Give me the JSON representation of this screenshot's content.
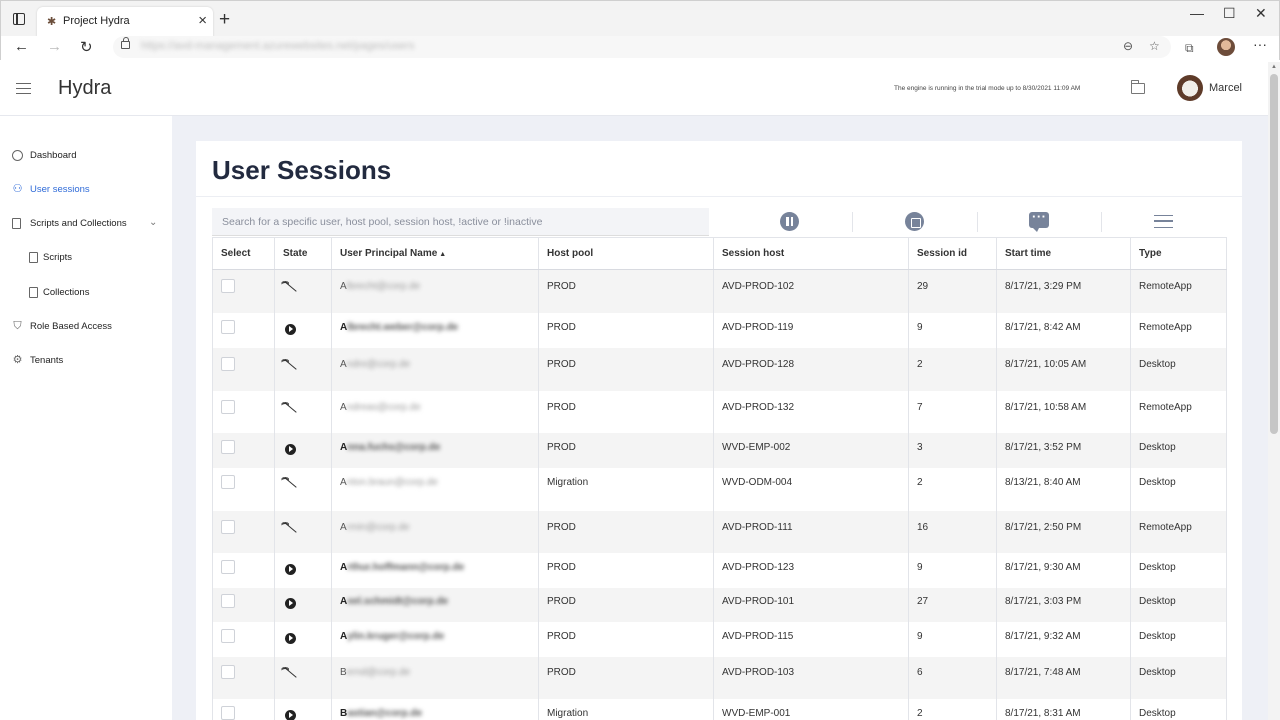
{
  "browser": {
    "tab_title": "Project Hydra",
    "url_blurred": "https://avd-management.azurewebsites.net/pages/users",
    "favicon": "hydra-favicon"
  },
  "header": {
    "app_title": "Hydra",
    "trial_note": "The engine is running in the trial mode up to 8/30/2021 11:09 AM",
    "user_name": "Marcel"
  },
  "sidebar": {
    "items": [
      {
        "label": "Dashboard",
        "icon": "dashboard-icon"
      },
      {
        "label": "User sessions",
        "icon": "users-icon",
        "active": true
      },
      {
        "label": "Scripts and Collections",
        "icon": "scripts-icon"
      },
      {
        "label": "Scripts",
        "icon": "page-icon"
      },
      {
        "label": "Collections",
        "icon": "page-icon"
      },
      {
        "label": "Role Based Access",
        "icon": "shield-icon"
      },
      {
        "label": "Tenants",
        "icon": "gear-icon"
      }
    ],
    "active_color": "#2f6bd8"
  },
  "main": {
    "title": "User Sessions",
    "search_placeholder": "Search for a specific user, host pool, session host, !active or !inactive",
    "actions": [
      "pause-icon",
      "stop-icon",
      "message-icon",
      "menu-icon"
    ]
  },
  "table": {
    "columns": [
      "Select",
      "State",
      "User Principal Name",
      "Host pool",
      "Session host",
      "Session id",
      "Start time",
      "Type"
    ],
    "sort_column": "User Principal Name",
    "rows": [
      {
        "state": "inactive",
        "upn_first": "A",
        "upn_blur": "lbrecht@corp.de",
        "host_pool": "PROD",
        "session_host": "AVD-PROD-102",
        "session_id": "29",
        "start_time": "8/17/21, 3:29 PM",
        "type": "RemoteApp"
      },
      {
        "state": "active",
        "upn_first": "A",
        "upn_blur": "lbrecht.weber@corp.de",
        "host_pool": "PROD",
        "session_host": "AVD-PROD-119",
        "session_id": "9",
        "start_time": "8/17/21, 8:42 AM",
        "type": "RemoteApp"
      },
      {
        "state": "inactive",
        "upn_first": "A",
        "upn_blur": "ndre@corp.de",
        "host_pool": "PROD",
        "session_host": "AVD-PROD-128",
        "session_id": "2",
        "start_time": "8/17/21, 10:05 AM",
        "type": "Desktop"
      },
      {
        "state": "inactive",
        "upn_first": "A",
        "upn_blur": "ndreas@corp.de",
        "host_pool": "PROD",
        "session_host": "AVD-PROD-132",
        "session_id": "7",
        "start_time": "8/17/21, 10:58 AM",
        "type": "RemoteApp"
      },
      {
        "state": "active",
        "upn_first": "A",
        "upn_blur": "nna.fuchs@corp.de",
        "host_pool": "PROD",
        "session_host": "WVD-EMP-002",
        "session_id": "3",
        "start_time": "8/17/21, 3:52 PM",
        "type": "Desktop"
      },
      {
        "state": "inactive",
        "upn_first": "A",
        "upn_blur": "nton.braun@corp.de",
        "host_pool": "Migration",
        "session_host": "WVD-ODM-004",
        "session_id": "2",
        "start_time": "8/13/21, 8:40 AM",
        "type": "Desktop"
      },
      {
        "state": "inactive",
        "upn_first": "A",
        "upn_blur": "rmin@corp.de",
        "host_pool": "PROD",
        "session_host": "AVD-PROD-111",
        "session_id": "16",
        "start_time": "8/17/21, 2:50 PM",
        "type": "RemoteApp"
      },
      {
        "state": "active",
        "upn_first": "A",
        "upn_blur": "rthur.hoffmann@corp.de",
        "host_pool": "PROD",
        "session_host": "AVD-PROD-123",
        "session_id": "9",
        "start_time": "8/17/21, 9:30 AM",
        "type": "Desktop"
      },
      {
        "state": "active",
        "upn_first": "A",
        "upn_blur": "xel.schmidt@corp.de",
        "host_pool": "PROD",
        "session_host": "AVD-PROD-101",
        "session_id": "27",
        "start_time": "8/17/21, 3:03 PM",
        "type": "Desktop"
      },
      {
        "state": "active",
        "upn_first": "A",
        "upn_blur": "ylin.kruger@corp.de",
        "host_pool": "PROD",
        "session_host": "AVD-PROD-115",
        "session_id": "9",
        "start_time": "8/17/21, 9:32 AM",
        "type": "Desktop"
      },
      {
        "state": "inactive",
        "upn_first": "B",
        "upn_blur": "ernd@corp.de",
        "host_pool": "PROD",
        "session_host": "AVD-PROD-103",
        "session_id": "6",
        "start_time": "8/17/21, 7:48 AM",
        "type": "Desktop"
      },
      {
        "state": "active",
        "upn_first": "B",
        "upn_blur": "astian@corp.de",
        "host_pool": "Migration",
        "session_host": "WVD-EMP-001",
        "session_id": "2",
        "start_time": "8/17/21, 8:31 AM",
        "type": "Desktop"
      }
    ]
  }
}
